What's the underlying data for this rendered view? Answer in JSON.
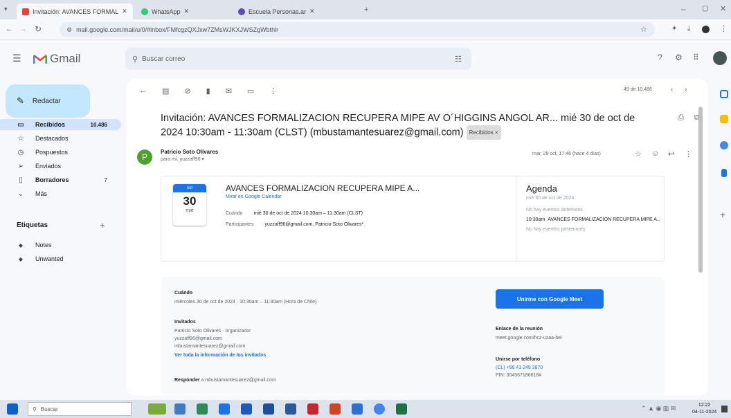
{
  "browser": {
    "tabs": [
      {
        "title": "Invitación: AVANCES FORMAL",
        "active": true
      },
      {
        "title": "WhatsApp",
        "active": false
      },
      {
        "title": "Escuela Personas.ar",
        "active": false
      }
    ],
    "url": "mail.google.com/mail/u/0/#inbox/FMfcgzQXJxw7ZMsWJKXJWSZgWbthlr"
  },
  "gmail": {
    "app_name": "Gmail",
    "search_placeholder": "Buscar correo",
    "compose_label": "Redactar",
    "nav": [
      {
        "label": "Recibidos",
        "count": "10.486",
        "icon": "inbox-icon",
        "selected": true
      },
      {
        "label": "Destacados",
        "count": "",
        "icon": "star-icon",
        "selected": false
      },
      {
        "label": "Pospuestos",
        "count": "",
        "icon": "clock-icon",
        "selected": false
      },
      {
        "label": "Enviados",
        "count": "",
        "icon": "send-icon",
        "selected": false
      },
      {
        "label": "Borradores",
        "count": "7",
        "icon": "draft-icon",
        "selected": false
      },
      {
        "label": "Más",
        "count": "",
        "icon": "chevron-down-icon",
        "selected": false
      }
    ],
    "labels_title": "Etiquetas",
    "labels": [
      {
        "label": "Notes"
      },
      {
        "label": "Unwanted"
      }
    ],
    "pagination": "49 de 10.486"
  },
  "email": {
    "subject": "Invitación: AVANCES FORMALIZACION RECUPERA MIPE AV O´HIGGINS ANGOL AR... mié 30 de oct de 2024 10:30am - 11:30am (CLST) (mbustamantesuarez@gmail.com)",
    "inbox_badge": "Recibidos ×",
    "sender": "Patricio Soto Olivares",
    "recipient": "para mí, yuzzaff96 ▾",
    "date": "mar, 29 oct, 17:46 (hace 4 días)",
    "avatar_letter": "P"
  },
  "invite": {
    "cal_month": "oct",
    "cal_day": "30",
    "cal_weekday": "mié",
    "title": "AVANCES FORMALIZACION RECUPERA MIPE A...",
    "link": "Mirar en Google Calendar",
    "when_label": "Cuándo",
    "when": "mié 30 de oct de 2024 10:30am – 11:30am (CLST)",
    "who_label": "Participantes",
    "who": "yuzzaff96@gmail.com, Patricio Soto Olivares*",
    "agenda_title": "Agenda",
    "agenda_date": "mié 30 de oct de 2024",
    "agenda_before": "No hay eventos anteriores",
    "agenda_time": "10:30am",
    "agenda_event": "AVANCES FORMALIZACION RECUPERA MIPE A...",
    "agenda_after": "No hay eventos posteriores"
  },
  "details": {
    "when_heading": "Cuándo",
    "when_text": "miércoles 30 de oct de 2024 · 10:30am – 11:30am (Hora de Chile)",
    "guests_heading": "Invitados",
    "guest1": "Patricio Soto Olivares · organizador",
    "guest2": "yuzzaff96@gmail.com",
    "guest3": "mbustamantesuarez@gmail.com",
    "guests_link": "Ver toda la información de los invitados",
    "reply_label": "Responder",
    "reply_email": "a mbustamantesuarez@gmail.com",
    "meet_button": "Unirme con Google Meet",
    "meet_link_heading": "Enlace de la reunión",
    "meet_link": "meet.google.com/hcz-uzaa-bei",
    "phone_heading": "Unirse por teléfono",
    "phone": "(CL) +56 41 245 2870",
    "pin": "PIN: 304567186618#"
  },
  "taskbar": {
    "search_placeholder": "Buscar",
    "time": "12:22",
    "date": "04-11-2024"
  },
  "colors": {
    "accent": "#1a73e8",
    "compose": "#c2e7ff",
    "selected_nav": "#d3e3fd",
    "avatar": "#4ea12c"
  }
}
